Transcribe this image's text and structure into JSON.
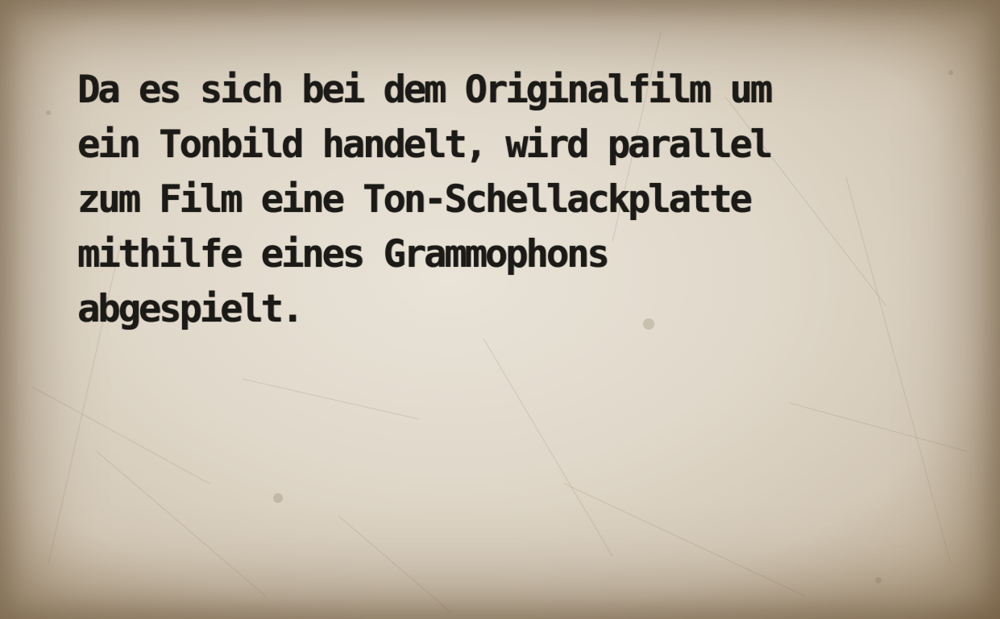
{
  "document": {
    "body_text": "Da es sich bei dem Originalfilm um\nein Tonbild handelt, wird parallel\nzum Film eine Ton-Schellackplatte\nmithilfe eines Grammophons\nabgespielt."
  },
  "colors": {
    "paper": "#e0d8ca",
    "edge": "#9c8a70",
    "ink": "#1c1a17"
  }
}
